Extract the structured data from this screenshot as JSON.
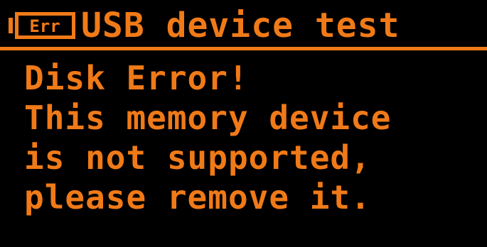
{
  "header": {
    "icon_name": "error-icon",
    "icon_text": "Err",
    "title": "USB device test"
  },
  "message": {
    "lines": [
      "Disk Error!",
      "This memory device",
      "is not supported,",
      "please remove it."
    ]
  },
  "colors": {
    "foreground": "#f07a18",
    "background": "#000000"
  }
}
